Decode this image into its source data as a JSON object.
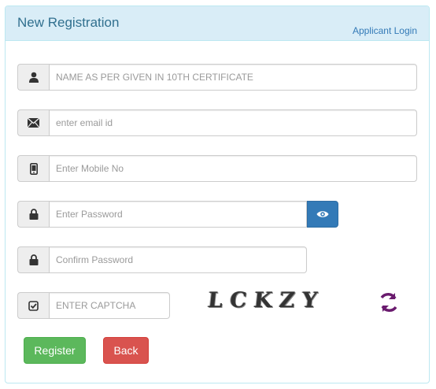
{
  "header": {
    "title": "New Registration",
    "login_link": "Applicant Login"
  },
  "form": {
    "name_placeholder": "NAME AS PER GIVEN IN 10TH CERTIFICATE",
    "email_placeholder": "enter email id",
    "mobile_placeholder": "Enter Mobile No",
    "password_placeholder": "Enter Password",
    "confirm_placeholder": "Confirm Password",
    "captcha_placeholder": "ENTER CAPTCHA",
    "captcha_text": "LCKZY"
  },
  "buttons": {
    "register": "Register",
    "back": "Back"
  },
  "colors": {
    "header_bg": "#d9edf7",
    "primary": "#337ab7",
    "success": "#5cb85c",
    "danger": "#d9534f",
    "refresh": "#6a1b6e"
  }
}
